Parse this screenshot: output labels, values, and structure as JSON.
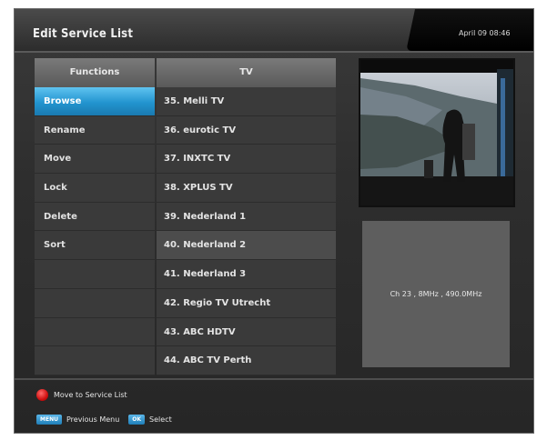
{
  "header": {
    "title": "Edit Service List",
    "datetime": "April 09 08:46"
  },
  "functions": {
    "heading": "Functions",
    "items": [
      {
        "label": "Browse",
        "selected": true
      },
      {
        "label": "Rename"
      },
      {
        "label": "Move"
      },
      {
        "label": "Lock"
      },
      {
        "label": "Delete"
      },
      {
        "label": "Sort"
      },
      {
        "label": ""
      },
      {
        "label": ""
      },
      {
        "label": ""
      },
      {
        "label": ""
      }
    ]
  },
  "channels": {
    "heading": "TV",
    "items": [
      {
        "label": "35. Melli TV"
      },
      {
        "label": "36. eurotic TV"
      },
      {
        "label": "37. INXTC TV"
      },
      {
        "label": "38. XPLUS TV"
      },
      {
        "label": "39. Nederland 1"
      },
      {
        "label": "40. Nederland 2",
        "selected": true
      },
      {
        "label": "41. Nederland 3"
      },
      {
        "label": "42. Regio TV Utrecht"
      },
      {
        "label": "43. ABC HDTV"
      },
      {
        "label": "44. ABC TV Perth"
      }
    ]
  },
  "info": {
    "text": "Ch 23 , 8MHz , 490.0MHz"
  },
  "footer": {
    "red_label": "Move to Service List",
    "menu_key": "MENU",
    "menu_label": "Previous Menu",
    "ok_key": "OK",
    "ok_label": "Select"
  },
  "colors": {
    "selection": "#2294cf",
    "red_button": "#d01010"
  }
}
